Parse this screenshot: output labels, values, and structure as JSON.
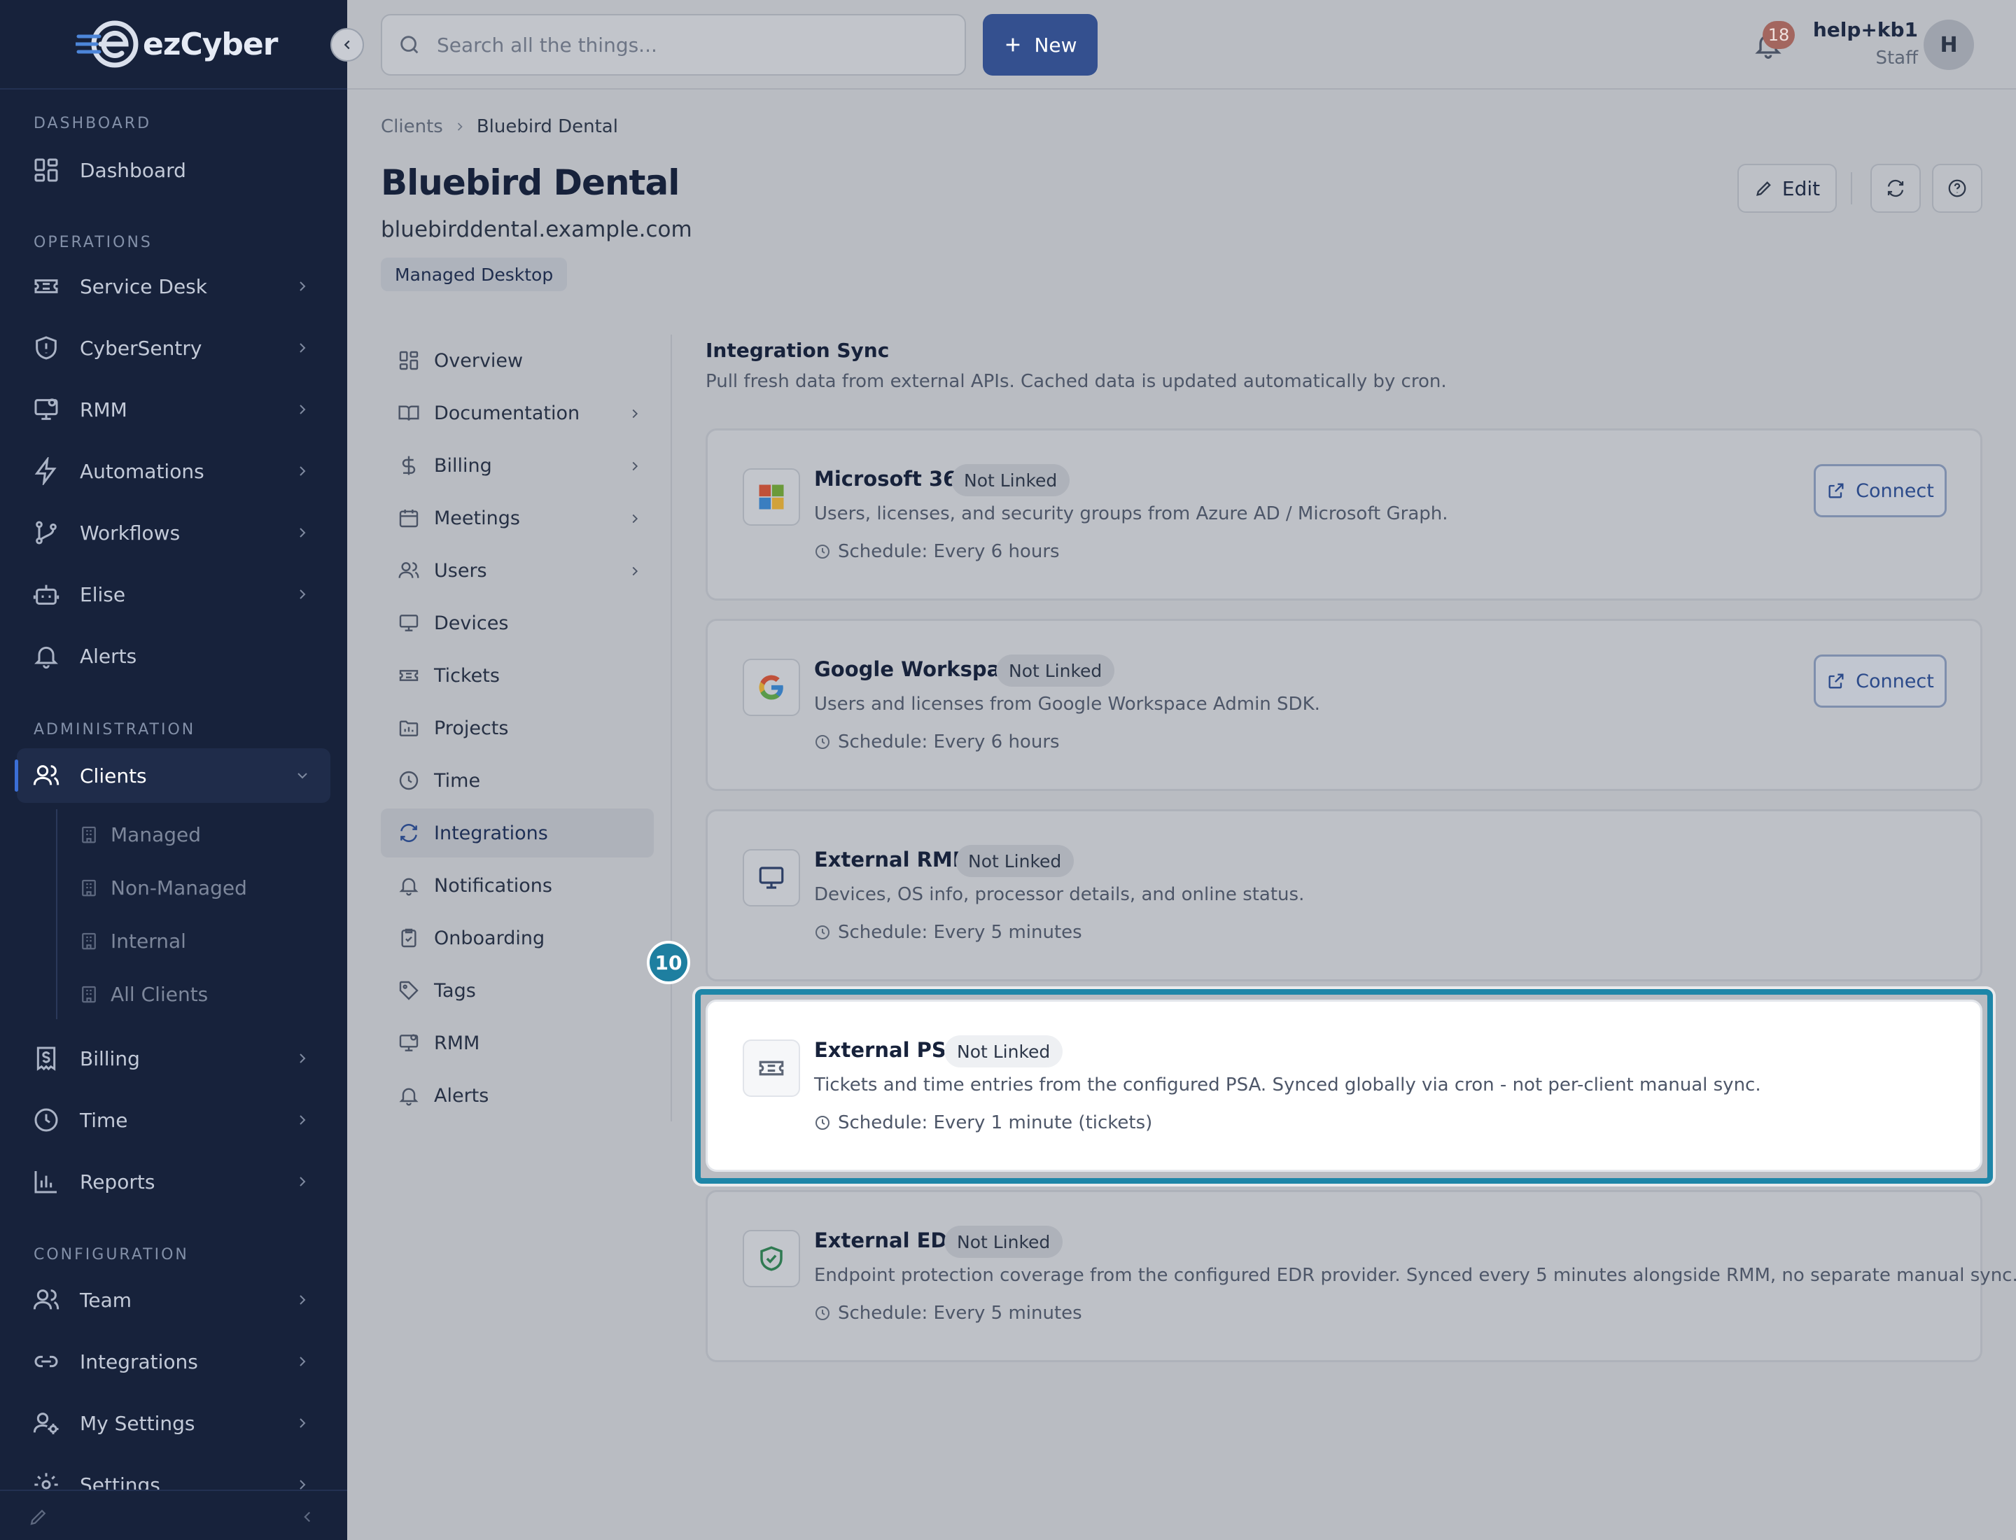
{
  "app": {
    "brand": "ezCyber"
  },
  "search": {
    "placeholder": "Search all the things..."
  },
  "topbar": {
    "new_label": "New",
    "notification_count": "18",
    "user_name": "help+kb1",
    "user_role": "Staff",
    "avatar_initial": "H"
  },
  "sidebar": {
    "sections": {
      "dashboard": "DASHBOARD",
      "operations": "OPERATIONS",
      "administration": "ADMINISTRATION",
      "configuration": "CONFIGURATION"
    },
    "items": [
      {
        "label": "Dashboard"
      },
      {
        "label": "Service Desk"
      },
      {
        "label": "CyberSentry"
      },
      {
        "label": "RMM"
      },
      {
        "label": "Automations"
      },
      {
        "label": "Workflows"
      },
      {
        "label": "Elise"
      },
      {
        "label": "Alerts"
      },
      {
        "label": "Clients"
      },
      {
        "label": "Billing"
      },
      {
        "label": "Time"
      },
      {
        "label": "Reports"
      },
      {
        "label": "Team"
      },
      {
        "label": "Integrations"
      },
      {
        "label": "My Settings"
      },
      {
        "label": "Settings"
      }
    ],
    "client_subitems": [
      {
        "label": "Managed"
      },
      {
        "label": "Non-Managed"
      },
      {
        "label": "Internal"
      },
      {
        "label": "All Clients"
      }
    ]
  },
  "breadcrumb": {
    "root": "Clients",
    "current": "Bluebird Dental"
  },
  "client": {
    "name": "Bluebird Dental",
    "domain": "bluebirddental.example.com",
    "tag": "Managed Desktop"
  },
  "header_actions": {
    "edit_label": "Edit"
  },
  "subnav": [
    {
      "label": "Overview"
    },
    {
      "label": "Documentation"
    },
    {
      "label": "Billing"
    },
    {
      "label": "Meetings"
    },
    {
      "label": "Users"
    },
    {
      "label": "Devices"
    },
    {
      "label": "Tickets"
    },
    {
      "label": "Projects"
    },
    {
      "label": "Time"
    },
    {
      "label": "Integrations"
    },
    {
      "label": "Notifications"
    },
    {
      "label": "Onboarding"
    },
    {
      "label": "Tags"
    },
    {
      "label": "RMM"
    },
    {
      "label": "Alerts"
    }
  ],
  "integration_sync": {
    "title": "Integration Sync",
    "description": "Pull fresh data from external APIs. Cached data is updated automatically by cron.",
    "connect_label": "Connect",
    "cards": [
      {
        "name": "Microsoft 365",
        "status": "Not Linked",
        "description": "Users, licenses, and security groups from Azure AD / Microsoft Graph.",
        "schedule": "Schedule: Every 6 hours",
        "icon": "microsoft-logo-icon"
      },
      {
        "name": "Google Workspace",
        "status": "Not Linked",
        "description": "Users and licenses from Google Workspace Admin SDK.",
        "schedule": "Schedule: Every 6 hours",
        "icon": "google-logo-icon"
      },
      {
        "name": "External RMM",
        "status": "Not Linked",
        "description": "Devices, OS info, processor details, and online status.",
        "schedule": "Schedule: Every 5 minutes",
        "icon": "monitor-icon"
      },
      {
        "name": "External PSA",
        "status": "Not Linked",
        "description": "Tickets and time entries from the configured PSA. Synced globally via cron - not per-client manual sync.",
        "schedule": "Schedule: Every 1 minute (tickets)",
        "icon": "ticket-icon"
      },
      {
        "name": "External EDR",
        "status": "Not Linked",
        "description": "Endpoint protection coverage from the configured EDR provider. Synced every 5 minutes alongside RMM, no separate manual sync.",
        "schedule": "Schedule: Every 5 minutes",
        "icon": "shield-check-icon"
      }
    ]
  },
  "annotation": {
    "step_number": "10"
  },
  "colors": {
    "accent": "#34508f",
    "highlight": "#1e86a8",
    "sidebar": "#17223b"
  }
}
